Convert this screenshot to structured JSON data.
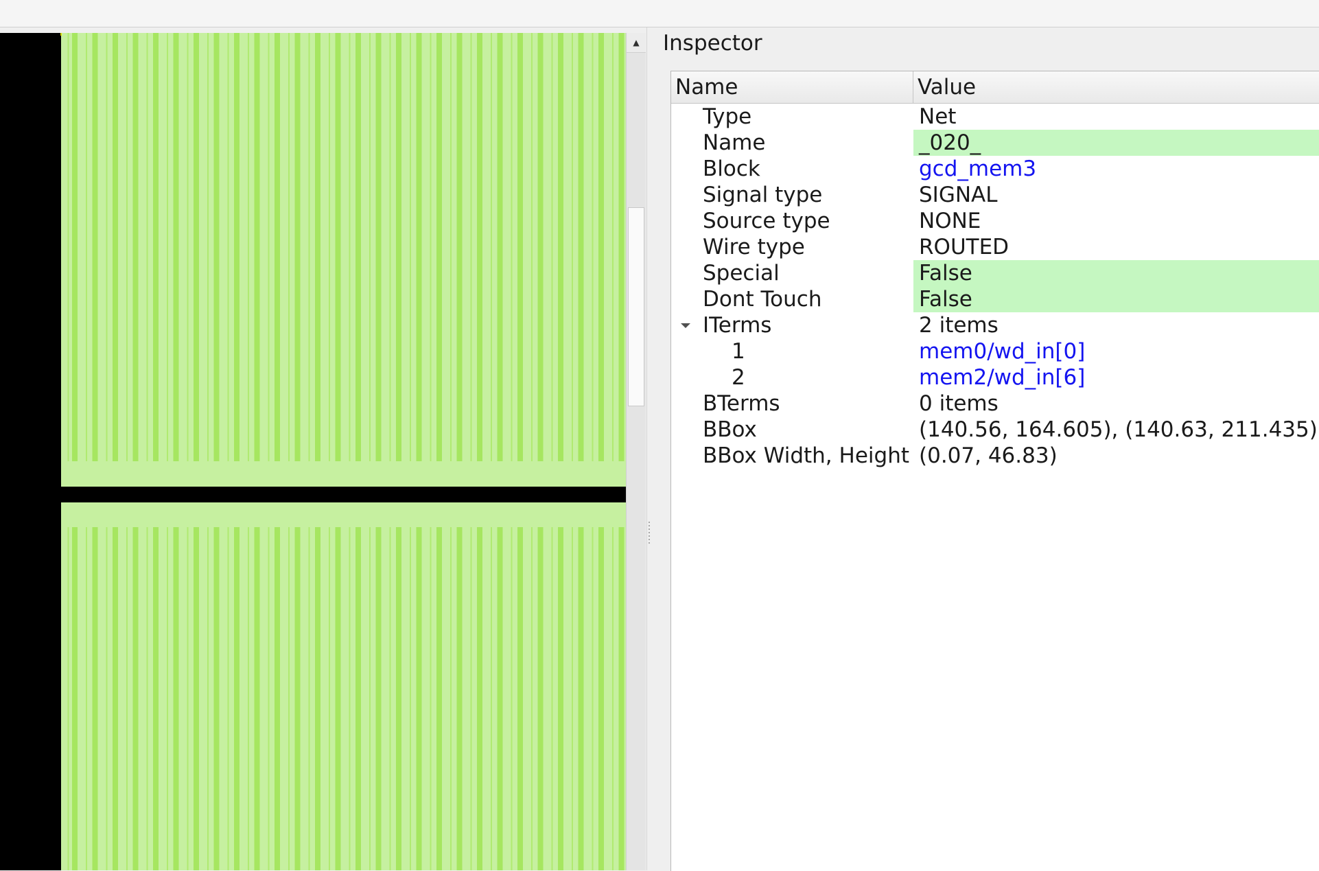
{
  "inspector": {
    "title": "Inspector",
    "columns": {
      "name": "Name",
      "value": "Value"
    },
    "rows": [
      {
        "name": "Type",
        "value": "Net"
      },
      {
        "name": "Name",
        "value": "_020_"
      },
      {
        "name": "Block",
        "value": "gcd_mem3"
      },
      {
        "name": "Signal type",
        "value": "SIGNAL"
      },
      {
        "name": "Source type",
        "value": "NONE"
      },
      {
        "name": "Wire type",
        "value": "ROUTED"
      },
      {
        "name": "Special",
        "value": "False"
      },
      {
        "name": "Dont Touch",
        "value": "False"
      },
      {
        "name": "ITerms",
        "value": "2 items"
      },
      {
        "name": "1",
        "value": "mem0/wd_in[0]"
      },
      {
        "name": "2",
        "value": "mem2/wd_in[6]"
      },
      {
        "name": "BTerms",
        "value": "0 items"
      },
      {
        "name": "BBox",
        "value": "(140.56, 164.605), (140.63, 211.435)"
      },
      {
        "name": "BBox Width, Height",
        "value": "(0.07, 46.83)"
      }
    ]
  },
  "colors": {
    "editable_value_bg": "#c5f7c1",
    "link_text": "#1414f0",
    "layout_background": "#000000",
    "instance_fill": "#c6f0a0",
    "instance_stripe": "#a6e660"
  },
  "icons": {
    "scroll_up": "up-arrow-icon",
    "tree_toggle": "triangle-down-icon"
  }
}
